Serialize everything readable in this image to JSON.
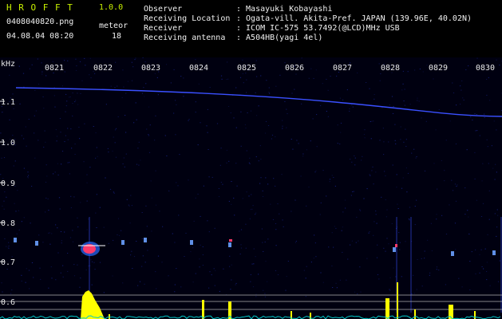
{
  "app": {
    "name": "H R O F F T",
    "version": "1.0.0"
  },
  "file": {
    "name": "0408040820.png",
    "datetime": "04.08.04 08:20"
  },
  "meteor": {
    "label": "meteor",
    "count": "18"
  },
  "info": [
    {
      "label": "Observer",
      "value": ": Masayuki Kobayashi"
    },
    {
      "label": "Receiving Location",
      "value": ": Ogata-vill. Akita-Pref. JAPAN (139.96E, 40.02N)"
    },
    {
      "label": "Receiver",
      "value": ": ICOM IC-575 53.7492(@LCD)MHz USB"
    },
    {
      "label": "Receiving antenna",
      "value": ": A504HB(yagi 4el)"
    }
  ],
  "spectrogram": {
    "y_unit": "kHz",
    "y_ticks": [
      "1.1",
      "1.0",
      "0.9",
      "0.8",
      "0.7",
      "0.6"
    ],
    "x_ticks": [
      "0821",
      "0822",
      "0823",
      "0824",
      "0825",
      "0826",
      "0827",
      "0828",
      "0829",
      "0830"
    ],
    "colors": {
      "background": "#000010",
      "noise": "#1c2aa0",
      "carrier": "#3a50ff",
      "echo": "#ff3b6b",
      "level": "#ffff00",
      "baseline": "#00c8c8",
      "grid": "#b0b0b0"
    }
  }
}
